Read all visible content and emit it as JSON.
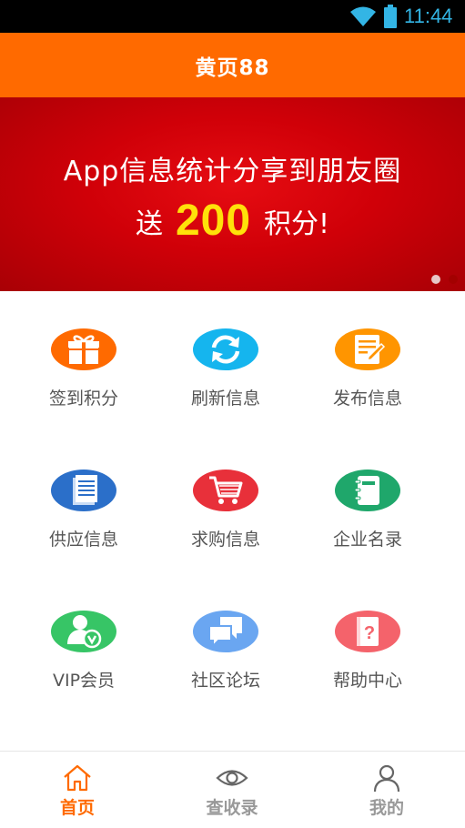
{
  "status_bar": {
    "time": "11:44",
    "icons": [
      "wifi-icon",
      "battery-icon"
    ]
  },
  "header": {
    "title": "黄页88"
  },
  "banner": {
    "line1": "App信息统计分享到朋友圈",
    "line2_prefix": "送",
    "points": "200",
    "line2_suffix": "积分!",
    "slides": 2,
    "active_slide": 1
  },
  "features": [
    {
      "label": "签到积分",
      "icon": "gift-icon",
      "color": "#ff6a00"
    },
    {
      "label": "刷新信息",
      "icon": "refresh-icon",
      "color": "#15b5ee"
    },
    {
      "label": "发布信息",
      "icon": "edit-note-icon",
      "color": "#ff9500"
    },
    {
      "label": "供应信息",
      "icon": "document-icon",
      "color": "#2b6fc9"
    },
    {
      "label": "求购信息",
      "icon": "cart-icon",
      "color": "#e8303a"
    },
    {
      "label": "企业名录",
      "icon": "notebook-icon",
      "color": "#1fa76b"
    },
    {
      "label": "VIP会员",
      "icon": "vip-user-icon",
      "color": "#37c566"
    },
    {
      "label": "社区论坛",
      "icon": "chat-icon",
      "color": "#6aa6f1"
    },
    {
      "label": "帮助中心",
      "icon": "help-book-icon",
      "color": "#f4636b"
    }
  ],
  "tabs": [
    {
      "label": "首页",
      "icon": "home-icon",
      "active": true
    },
    {
      "label": "查收录",
      "icon": "eye-icon",
      "active": false
    },
    {
      "label": "我的",
      "icon": "user-icon",
      "active": false
    }
  ],
  "colors": {
    "accent": "#ff6a00",
    "banner_red": "#d00008",
    "points_yellow": "#ffe10a",
    "tab_inactive": "#999999"
  }
}
